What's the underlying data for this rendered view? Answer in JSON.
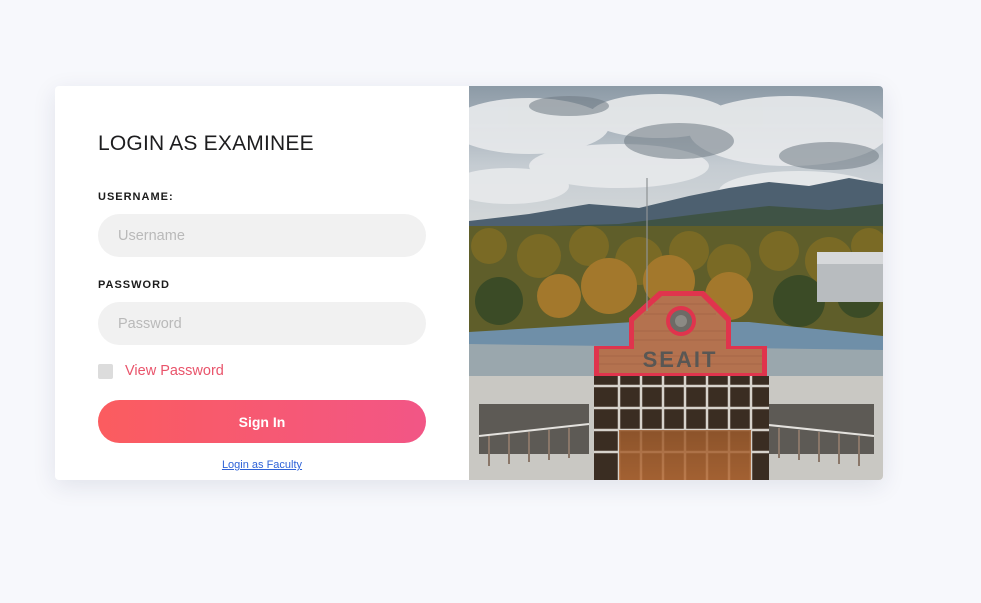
{
  "login": {
    "title": "LOGIN AS EXAMINEE",
    "username_label": "USERNAME:",
    "username_placeholder": "Username",
    "username_value": "",
    "password_label": "PASSWORD",
    "password_placeholder": "Password",
    "password_value": "",
    "view_password_label": "View Password",
    "view_password_checked": false,
    "sign_in_label": "Sign In",
    "faculty_link": "Login as Faculty"
  },
  "photo": {
    "building_sign": "SEAIT"
  },
  "colors": {
    "page_background": "#f7f8fc",
    "accent_pink": "#e9546b",
    "button_gradient_start": "#fb5c5f",
    "button_gradient_end": "#f25686",
    "link_blue": "#2f63d8"
  }
}
